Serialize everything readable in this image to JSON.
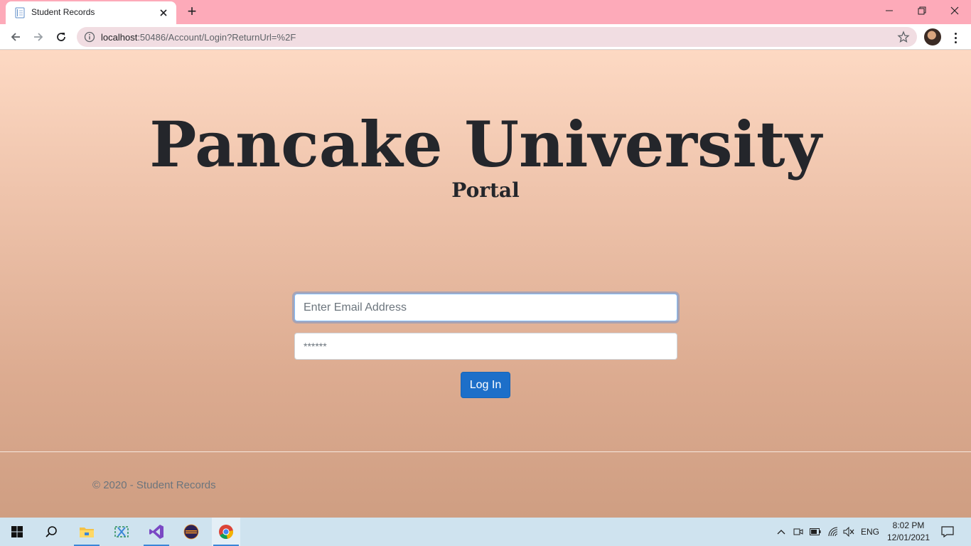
{
  "browser": {
    "tab_title": "Student Records",
    "url_host": "localhost",
    "url_path": ":50486/Account/Login?ReturnUrl=%2F",
    "icons": {
      "back": "arrow-left-icon",
      "forward": "arrow-right-icon",
      "reload": "reload-icon",
      "info": "info-icon",
      "bookmark": "star-icon",
      "menu": "kebab-menu-icon"
    }
  },
  "page": {
    "title": "Pancake University",
    "subtitle": "Portal",
    "email_placeholder": "Enter Email Address",
    "password_placeholder": "******",
    "login_label": "Log In",
    "footer": "© 2020 - Student Records"
  },
  "taskbar": {
    "apps": [
      "start-icon",
      "search-icon",
      "file-explorer-icon",
      "snipping-tool-icon",
      "visual-studio-icon",
      "eclipse-icon",
      "chrome-icon"
    ],
    "language": "ENG",
    "time": "8:02 PM",
    "date": "12/01/2021"
  },
  "colors": {
    "tabbar": "#fdaab9",
    "page_top": "#fdd9c3",
    "page_bottom": "#cf9e82",
    "button": "#1d6fc9",
    "title_text": "#24262b"
  }
}
